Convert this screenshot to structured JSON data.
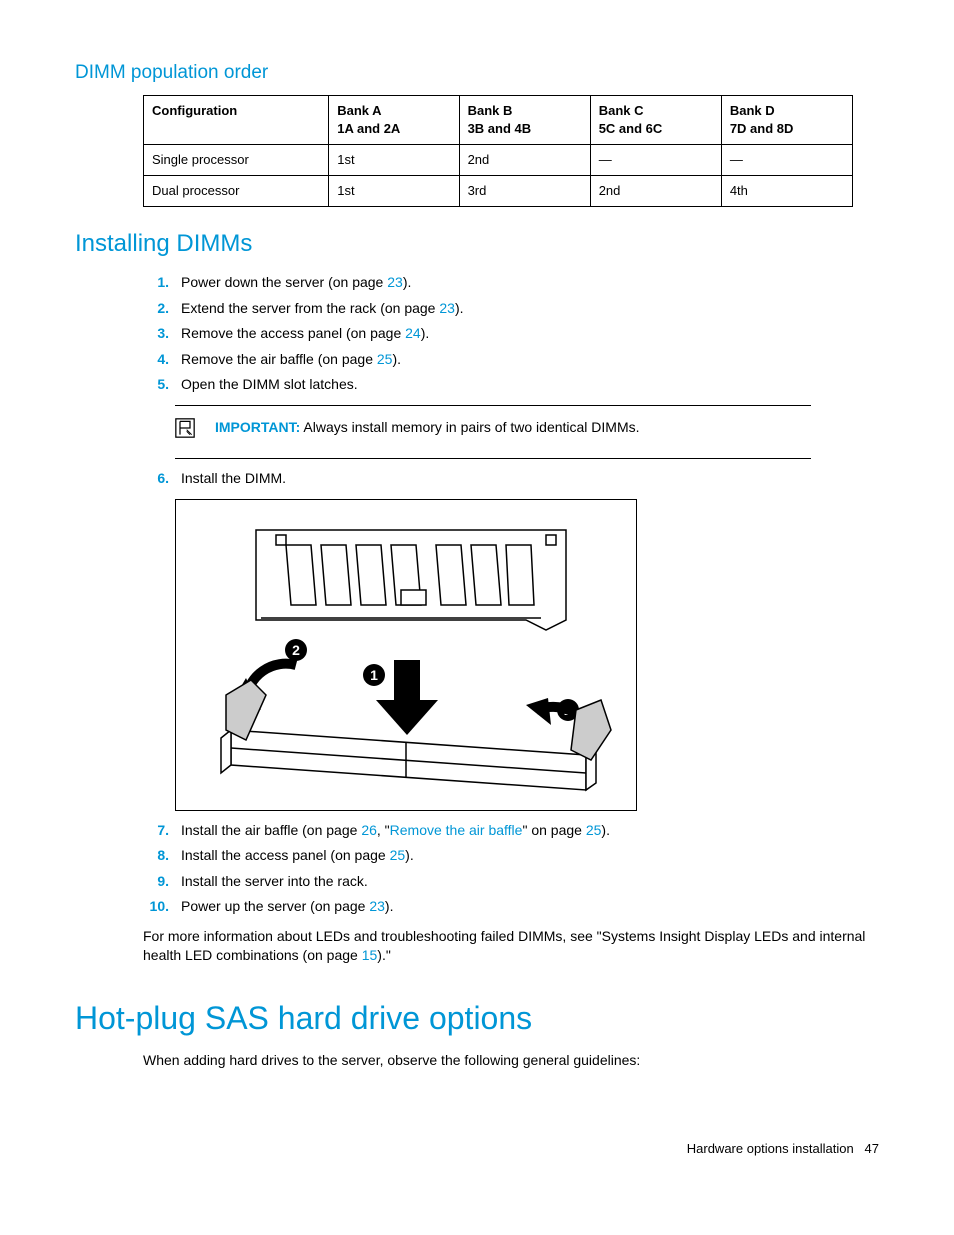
{
  "headings": {
    "h3_dimm_order": "DIMM population order",
    "h2_installing": "Installing DIMMs",
    "h1_hotplug": "Hot-plug SAS hard drive options"
  },
  "table": {
    "headers": {
      "config": "Configuration",
      "bankA_l1": "Bank A",
      "bankA_l2": "1A and 2A",
      "bankB_l1": "Bank B",
      "bankB_l2": "3B and 4B",
      "bankC_l1": "Bank C",
      "bankC_l2": "5C and 6C",
      "bankD_l1": "Bank D",
      "bankD_l2": "7D and 8D"
    },
    "rows": [
      {
        "config": "Single processor",
        "a": "1st",
        "b": "2nd",
        "c": "—",
        "d": "—"
      },
      {
        "config": "Dual processor",
        "a": "1st",
        "b": "3rd",
        "c": "2nd",
        "d": "4th"
      }
    ]
  },
  "steps": {
    "s1_pre": "Power down the server (on page ",
    "s1_link": "23",
    "s1_post": ").",
    "s2_pre": "Extend the server from the rack (on page ",
    "s2_link": "23",
    "s2_post": ").",
    "s3_pre": "Remove the access panel (on page ",
    "s3_link": "24",
    "s3_post": ").",
    "s4_pre": "Remove the air baffle (on page ",
    "s4_link": "25",
    "s4_post": ").",
    "s5": "Open the DIMM slot latches.",
    "s6": "Install the DIMM.",
    "s7_pre": "Install the air baffle (on page ",
    "s7_link1": "26",
    "s7_mid": ", \"",
    "s7_link2": "Remove the air baffle",
    "s7_mid2": "\" on page ",
    "s7_link3": "25",
    "s7_post": ").",
    "s8_pre": "Install the access panel (on page ",
    "s8_link": "25",
    "s8_post": ").",
    "s9": "Install the server into the rack.",
    "s10_pre": "Power up the server (on page ",
    "s10_link": "23",
    "s10_post": ").",
    "nums": {
      "n1": "1.",
      "n2": "2.",
      "n3": "3.",
      "n4": "4.",
      "n5": "5.",
      "n6": "6.",
      "n7": "7.",
      "n8": "8.",
      "n9": "9.",
      "n10": "10."
    }
  },
  "important": {
    "label": "IMPORTANT:",
    "text": "  Always install memory in pairs of two identical DIMMs."
  },
  "post_para_pre": "For more information about LEDs and troubleshooting failed DIMMs, see \"Systems Insight Display LEDs and internal health LED combinations (on page ",
  "post_para_link": "15",
  "post_para_post": ").\"",
  "hotplug_intro": "When adding hard drives to the server, observe the following general guidelines:",
  "figure_callouts": {
    "c1": "1",
    "c2a": "2",
    "c2b": "2"
  },
  "footer": {
    "section": "Hardware options installation",
    "page": "47"
  }
}
